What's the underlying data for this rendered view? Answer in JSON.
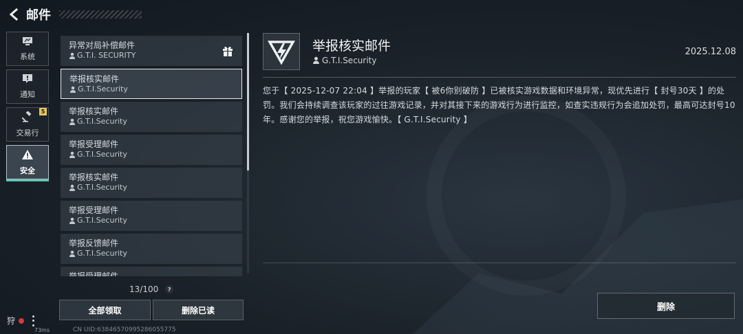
{
  "header": {
    "title": "邮件"
  },
  "nav": [
    {
      "label": "系统",
      "icon": "monitor-icon",
      "active": false
    },
    {
      "label": "通知",
      "icon": "alert-box-icon",
      "active": false
    },
    {
      "label": "交易行",
      "icon": "gavel-icon",
      "active": false,
      "badge": "5"
    },
    {
      "label": "安全",
      "icon": "warning-icon",
      "active": true
    }
  ],
  "mails": [
    {
      "subject": "异常对局补偿邮件",
      "sender": "G.T.I. SECURITY",
      "has_gift": true
    },
    {
      "subject": "举报核实邮件",
      "sender": "G.T.I.Security",
      "selected": true
    },
    {
      "subject": "举报核实邮件",
      "sender": "G.T.I.Security"
    },
    {
      "subject": "举报受理邮件",
      "sender": "G.T.I.Security"
    },
    {
      "subject": "举报核实邮件",
      "sender": "G.T.I.Security"
    },
    {
      "subject": "举报受理邮件",
      "sender": "G.T.I.Security"
    },
    {
      "subject": "举报反馈邮件",
      "sender": "G.T.I.Security"
    },
    {
      "subject": "举报受理邮件",
      "sender": ""
    }
  ],
  "counter": "13/100",
  "buttons": {
    "claim_all": "全部领取",
    "delete_read": "删除已读",
    "delete": "删除"
  },
  "detail": {
    "title": "举报核实邮件",
    "sender": "G.T.I.Security",
    "date": "2025.12.08",
    "body": "您于【 2025-12-07 22:04 】举报的玩家【 被6你别破防 】已被核实游戏数据和环境异常，现优先进行【 封号30天 】的处罚。我们会持续调查该玩家的过往游戏记录，并对其接下来的游戏行为进行监控，如查实违规行为会追加处罚，最高可达封号10年。感谢您的举报，祝您游戏愉快。【 G.T.I.Security 】"
  },
  "status": {
    "hunt_label": "狩",
    "ping": "73ms",
    "uid": "CN UID:63846570995286055775"
  },
  "colors": {
    "accent": "#59c9b4",
    "badge": "#e8c75a",
    "rec": "#d33a3a"
  }
}
